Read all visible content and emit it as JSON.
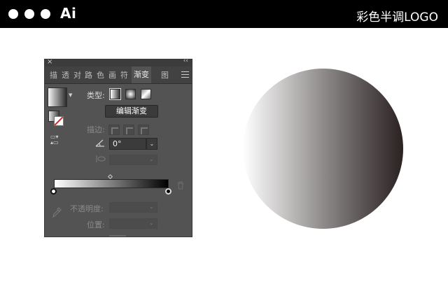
{
  "banner": {
    "brand": "Ai",
    "title": "彩色半调LOGO"
  },
  "panel": {
    "close_glyph": "×",
    "collapse_glyph": "‹‹",
    "tabs": [
      {
        "label": "描"
      },
      {
        "label": "透"
      },
      {
        "label": "对"
      },
      {
        "label": "路"
      },
      {
        "label": "色"
      },
      {
        "label": "画"
      },
      {
        "label": "符"
      },
      {
        "label": "渐变",
        "active": true
      },
      {
        "label": "图"
      }
    ],
    "type_label": "类型:",
    "gradient_types": [
      "linear",
      "radial",
      "freeform"
    ],
    "edit_button": "编辑渐变",
    "stroke_label": "描边:",
    "angle_value": "0°",
    "opacity_label": "不透明度:",
    "location_label": "位置:",
    "dropdown_glyph": "⌄",
    "selected_gradient_type": "linear"
  },
  "gradient_stops": [
    {
      "color": "#ffffff",
      "location": 0
    },
    {
      "color": "#000000",
      "location": 100
    }
  ],
  "canvas": {
    "shape": "circle",
    "fill_colors": [
      "#ffffff",
      "#2b2222"
    ]
  },
  "icons": [
    "window-dot",
    "close-icon",
    "collapse-icon",
    "panel-menu-icon",
    "angle-icon",
    "aspect-ratio-icon",
    "trash-icon",
    "eyedropper-icon",
    "swap-icon"
  ]
}
